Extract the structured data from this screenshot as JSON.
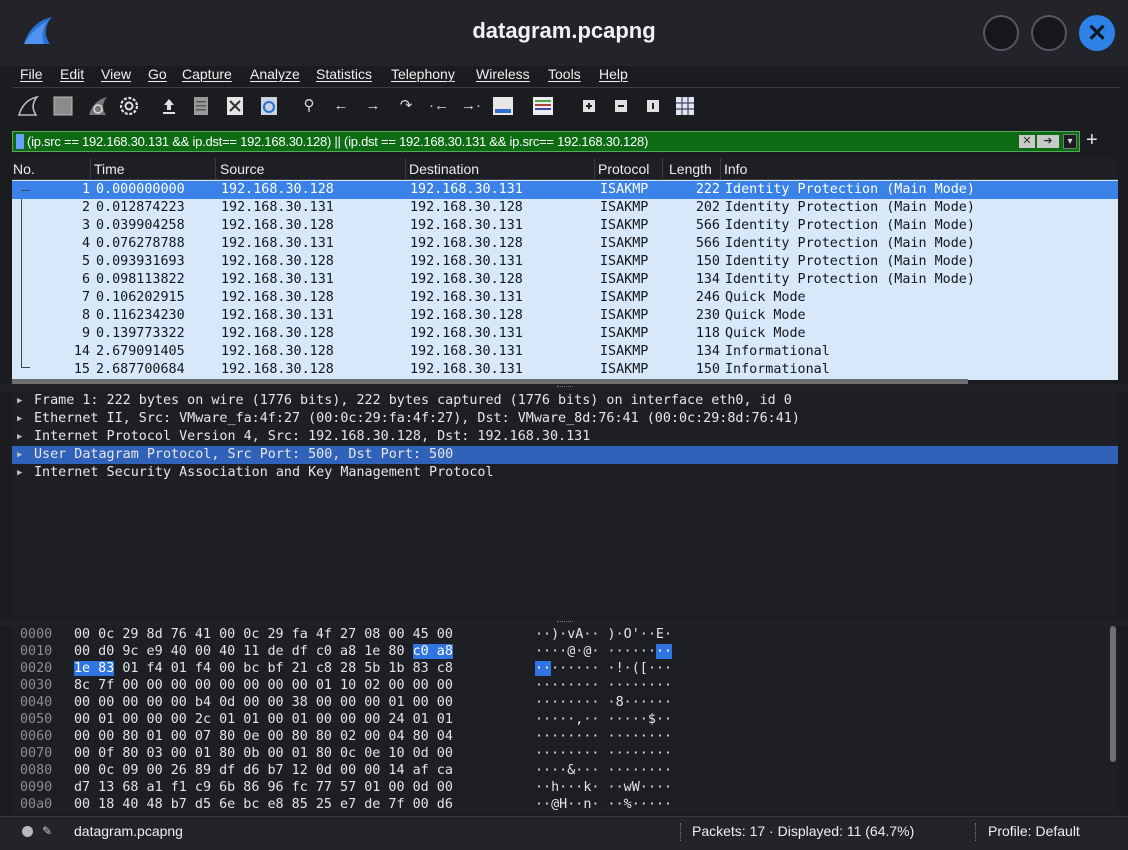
{
  "window": {
    "title": "datagram.pcapng"
  },
  "menu": [
    "File",
    "Edit",
    "View",
    "Go",
    "Capture",
    "Analyze",
    "Statistics",
    "Telephony",
    "Wireless",
    "Tools",
    "Help"
  ],
  "toolbar_icons": [
    "shark-fin-start-icon",
    "stop-icon",
    "restart-icon",
    "options-gear-icon",
    "open-icon",
    "save-icon",
    "close-file-icon",
    "reload-icon",
    "find-icon",
    "back-icon",
    "forward-icon",
    "go-to-packet-icon",
    "first-packet-icon",
    "last-packet-icon",
    "autoscroll-icon",
    "colorize-icon",
    "zoom-in-icon",
    "zoom-out-icon",
    "normal-size-icon",
    "resize-columns-icon"
  ],
  "filter": {
    "text": "(ip.src == 192.168.30.131  && ip.dst== 192.168.30.128) || (ip.dst == 192.168.30.131  && ip.src== 192.168.30.128)",
    "valid_color": "#0c6b13"
  },
  "packet_list": {
    "headers": {
      "no": "No.",
      "time": "Time",
      "source": "Source",
      "destination": "Destination",
      "protocol": "Protocol",
      "length": "Length",
      "info": "Info"
    },
    "rows": [
      {
        "no": "1",
        "time": "0.000000000",
        "source": "192.168.30.128",
        "destination": "192.168.30.131",
        "protocol": "ISAKMP",
        "length": "222",
        "info": "Identity Protection (Main Mode)",
        "selected": true
      },
      {
        "no": "2",
        "time": "0.012874223",
        "source": "192.168.30.131",
        "destination": "192.168.30.128",
        "protocol": "ISAKMP",
        "length": "202",
        "info": "Identity Protection (Main Mode)"
      },
      {
        "no": "3",
        "time": "0.039904258",
        "source": "192.168.30.128",
        "destination": "192.168.30.131",
        "protocol": "ISAKMP",
        "length": "566",
        "info": "Identity Protection (Main Mode)"
      },
      {
        "no": "4",
        "time": "0.076278788",
        "source": "192.168.30.131",
        "destination": "192.168.30.128",
        "protocol": "ISAKMP",
        "length": "566",
        "info": "Identity Protection (Main Mode)"
      },
      {
        "no": "5",
        "time": "0.093931693",
        "source": "192.168.30.128",
        "destination": "192.168.30.131",
        "protocol": "ISAKMP",
        "length": "150",
        "info": "Identity Protection (Main Mode)"
      },
      {
        "no": "6",
        "time": "0.098113822",
        "source": "192.168.30.131",
        "destination": "192.168.30.128",
        "protocol": "ISAKMP",
        "length": "134",
        "info": "Identity Protection (Main Mode)"
      },
      {
        "no": "7",
        "time": "0.106202915",
        "source": "192.168.30.128",
        "destination": "192.168.30.131",
        "protocol": "ISAKMP",
        "length": "246",
        "info": "Quick Mode"
      },
      {
        "no": "8",
        "time": "0.116234230",
        "source": "192.168.30.131",
        "destination": "192.168.30.128",
        "protocol": "ISAKMP",
        "length": "230",
        "info": "Quick Mode"
      },
      {
        "no": "9",
        "time": "0.139773322",
        "source": "192.168.30.128",
        "destination": "192.168.30.131",
        "protocol": "ISAKMP",
        "length": "118",
        "info": "Quick Mode"
      },
      {
        "no": "14",
        "time": "2.679091405",
        "source": "192.168.30.128",
        "destination": "192.168.30.131",
        "protocol": "ISAKMP",
        "length": "134",
        "info": "Informational"
      },
      {
        "no": "15",
        "time": "2.687700684",
        "source": "192.168.30.128",
        "destination": "192.168.30.131",
        "protocol": "ISAKMP",
        "length": "150",
        "info": "Informational"
      }
    ]
  },
  "details": [
    {
      "text": "Frame 1: 222 bytes on wire (1776 bits), 222 bytes captured (1776 bits) on interface eth0, id 0"
    },
    {
      "text": "Ethernet II, Src: VMware_fa:4f:27 (00:0c:29:fa:4f:27), Dst: VMware_8d:76:41 (00:0c:29:8d:76:41)"
    },
    {
      "text": "Internet Protocol Version 4, Src: 192.168.30.128, Dst: 192.168.30.131"
    },
    {
      "text": "User Datagram Protocol, Src Port: 500, Dst Port: 500",
      "selected": true
    },
    {
      "text": "Internet Security Association and Key Management Protocol"
    }
  ],
  "bytes": [
    {
      "offset": "0000",
      "hex": "00 0c 29 8d 76 41 00 0c  29 fa 4f 27 08 00 45 00",
      "ascii": "··)·vA·· )·O'··E·"
    },
    {
      "offset": "0010",
      "hex_pre": "00 d0 9c e9 40 00 40 11  de df c0 a8 1e 80 ",
      "hex_hl": "c0 a8",
      "ascii_pre": "····@·@· ······",
      "ascii_hl": "··"
    },
    {
      "offset": "0020",
      "hex_hl": "1e 83",
      "hex_post": " 01 f4 01 f4 00 bc  bf 21 c8 28 5b 1b 83 c8",
      "ascii_hl": "··",
      "ascii_post": "······ ·!·([···"
    },
    {
      "offset": "0030",
      "hex": "8c 7f 00 00 00 00 00 00  00 00 01 10 02 00 00 00",
      "ascii": "········ ········"
    },
    {
      "offset": "0040",
      "hex": "00 00 00 00 00 b4 0d 00  00 38 00 00 00 01 00 00",
      "ascii": "········ ·8······"
    },
    {
      "offset": "0050",
      "hex": "00 01 00 00 00 2c 01 01  00 01 00 00 00 24 01 01",
      "ascii": "·····,·· ·····$··"
    },
    {
      "offset": "0060",
      "hex": "00 00 80 01 00 07 80 0e  00 80 80 02 00 04 80 04",
      "ascii": "········ ········"
    },
    {
      "offset": "0070",
      "hex": "00 0f 80 03 00 01 80 0b  00 01 80 0c 0e 10 0d 00",
      "ascii": "········ ········"
    },
    {
      "offset": "0080",
      "hex": "00 0c 09 00 26 89 df d6  b7 12 0d 00 00 14 af ca",
      "ascii": "····&··· ········"
    },
    {
      "offset": "0090",
      "hex": "d7 13 68 a1 f1 c9 6b 86  96 fc 77 57 01 00 0d 00",
      "ascii": "··h···k· ··wW····"
    },
    {
      "offset": "00a0",
      "hex": "00 18 40 48 b7 d5 6e bc  e8 85 25 e7 de 7f 00 d6",
      "ascii": "··@H··n· ··%·····"
    }
  ],
  "status": {
    "file": "datagram.pcapng",
    "packets": "Packets: 17 · Displayed: 11 (64.7%)",
    "profile": "Profile: Default"
  },
  "colors": {
    "selection": "#3a81e8",
    "row_background": "#d6e8fa",
    "filter_valid": "#0c6b13",
    "close_button": "#2c82e6"
  }
}
